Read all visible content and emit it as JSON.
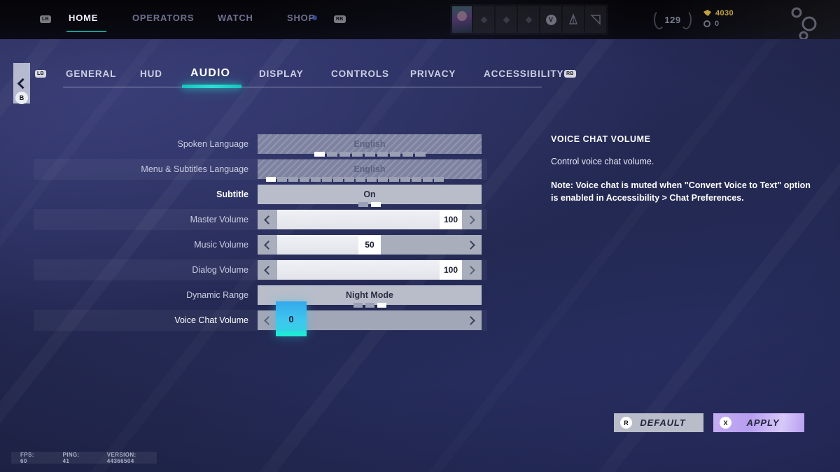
{
  "topnav": {
    "lb_badge": "LB",
    "rb_badge": "RB",
    "items": [
      {
        "label": "HOME",
        "active": true
      },
      {
        "label": "OPERATORS",
        "active": false
      },
      {
        "label": "WATCH",
        "active": false
      },
      {
        "label": "SHOP",
        "active": false
      }
    ]
  },
  "player": {
    "level": "129",
    "currency_gold": "4030",
    "currency_silver": "0",
    "slot_v_label": "V"
  },
  "settings_tabs": {
    "lb_badge": "LB",
    "rb_badge": "RB",
    "back_badge": "B",
    "items": [
      {
        "label": "GENERAL",
        "active": false
      },
      {
        "label": "HUD",
        "active": false
      },
      {
        "label": "AUDIO",
        "active": true
      },
      {
        "label": "DISPLAY",
        "active": false
      },
      {
        "label": "CONTROLS",
        "active": false
      },
      {
        "label": "PRIVACY",
        "active": false
      },
      {
        "label": "ACCESSIBILITY",
        "active": false
      }
    ]
  },
  "settings_rows": [
    {
      "label": "Spoken Language",
      "type": "option",
      "value": "English",
      "disabled": true,
      "segments": 9,
      "selected_segment": 0
    },
    {
      "label": "Menu & Subtitles Language",
      "type": "option",
      "value": "English",
      "disabled": true,
      "segments": 16,
      "selected_segment": 0
    },
    {
      "label": "Subtitle",
      "type": "option",
      "value": "On",
      "disabled": false,
      "segments": 2,
      "selected_segment": 1
    },
    {
      "label": "Master Volume",
      "type": "slider",
      "value": "100",
      "percent": 100
    },
    {
      "label": "Music Volume",
      "type": "slider",
      "value": "50",
      "percent": 50
    },
    {
      "label": "Dialog Volume",
      "type": "slider",
      "value": "100",
      "percent": 100
    },
    {
      "label": "Dynamic Range",
      "type": "option",
      "value": "Night Mode",
      "disabled": false,
      "segments": 3,
      "selected_segment": 2
    },
    {
      "label": "Voice Chat Volume",
      "type": "slider",
      "value": "0",
      "percent": 0,
      "selected": true
    }
  ],
  "info_panel": {
    "title": "VOICE CHAT VOLUME",
    "description": "Control voice chat volume.",
    "note": "Note: Voice chat is muted when \"Convert Voice to Text\" option is enabled in Accessibility > Chat Preferences."
  },
  "footer_buttons": [
    {
      "badge": "R",
      "label": "DEFAULT"
    },
    {
      "badge": "X",
      "label": "APPLY"
    }
  ],
  "status_bar": {
    "fps": "FPS: 60",
    "ping": "PING: 41",
    "version": "VERSION: 44366504"
  },
  "colors": {
    "accent_cyan": "#2ae0d4",
    "background_navy": "#262b5e",
    "apply_purple": "#bb9ff0",
    "gold": "#c2a03d"
  }
}
